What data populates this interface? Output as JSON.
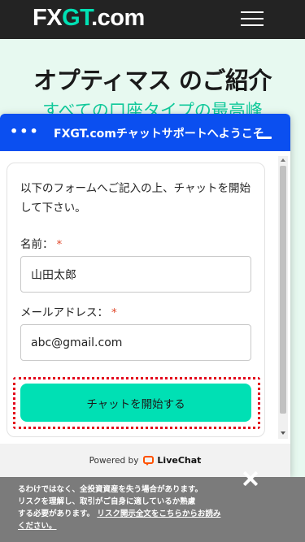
{
  "site": {
    "logo": {
      "part1": "FX",
      "part2": "GT",
      "part3": ".com"
    },
    "menu_icon": "hamburger-menu-icon"
  },
  "hero": {
    "title": "オプティマス のご紹介",
    "subtitle": "すべての口座タイプの最高峰"
  },
  "chat": {
    "menu_icon": "more-dots-icon",
    "dots": "•••",
    "title": "FXGT.comチャットサポートへようこそ",
    "minimize_icon": "minimize-icon",
    "intro": "以下のフォームへご記入の上、チャットを開始して下さい。",
    "name_label": "名前：",
    "name_required": "*",
    "name_value": "山田太郎",
    "email_label": "メールアドレス：",
    "email_required": "*",
    "email_value": "abc@gmail.com",
    "start_button": "チャットを開始する",
    "powered_by": "Powered by",
    "brand_icon": "livechat-logo-icon",
    "brand": "LiveChat"
  },
  "risk_banner": {
    "text_line1": "るわけではなく、全投資資産を失う場合があります。",
    "text_line2": "リスクを理解し、取引がご自身に適しているか熟慮",
    "text_line3": "する必要があります。",
    "link": "リスク開示全文をこちらからお読みください。",
    "close_icon": "close-icon"
  },
  "colors": {
    "accent": "#00e0b4",
    "chat_header": "#0b4ff0",
    "highlight": "#e3001b",
    "required": "#e0492b"
  }
}
